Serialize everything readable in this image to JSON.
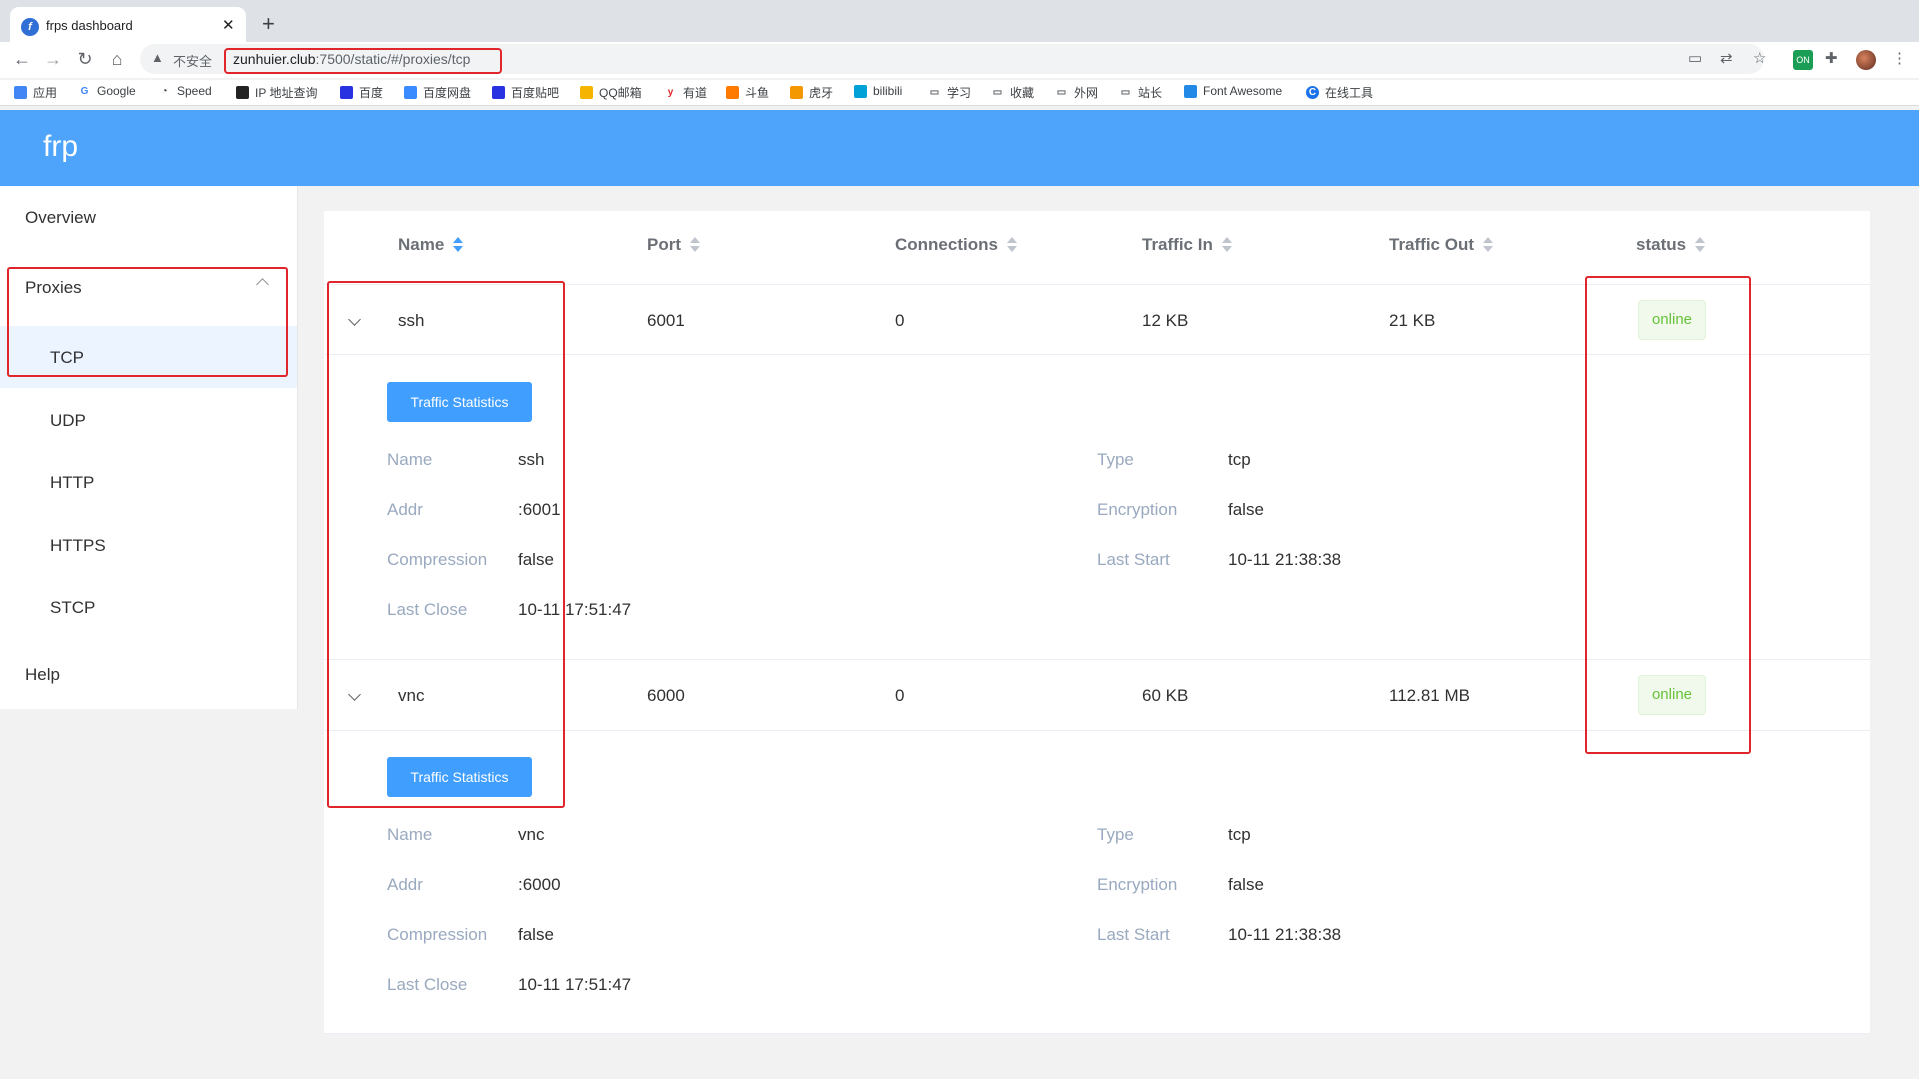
{
  "browser": {
    "tab_title": "frps dashboard",
    "tab_close": "✕",
    "new_tab": "+",
    "security_label": "不安全",
    "url_host": "zunhuier.club",
    "url_path": ":7500/static/#/proxies/tcp",
    "bookmarks": [
      "应用",
      "Google",
      "Speed",
      "IP 地址查询",
      "百度",
      "百度网盘",
      "百度贴吧",
      "QQ邮箱",
      "有道",
      "斗鱼",
      "虎牙",
      "bilibili",
      "学习",
      "收藏",
      "外网",
      "站长",
      "Font Awesome",
      "在线工具"
    ]
  },
  "app": {
    "logo": "frp",
    "menu": {
      "overview": "Overview",
      "proxies": "Proxies",
      "tcp": "TCP",
      "udp": "UDP",
      "http": "HTTP",
      "https": "HTTPS",
      "stcp": "STCP",
      "help": "Help"
    },
    "table": {
      "headers": [
        "Name",
        "Port",
        "Connections",
        "Traffic In",
        "Traffic Out",
        "status"
      ],
      "button_label": "Traffic Statistics",
      "detail_labels": {
        "name": "Name",
        "addr": "Addr",
        "compression": "Compression",
        "last_close": "Last Close",
        "type": "Type",
        "encryption": "Encryption",
        "last_start": "Last Start"
      },
      "rows": [
        {
          "name": "ssh",
          "port": "6001",
          "connections": "0",
          "traffic_in": "12 KB",
          "traffic_out": "21 KB",
          "status": "online",
          "detail": {
            "name": "ssh",
            "addr": ":6001",
            "compression": "false",
            "last_close": "10-11 17:51:47",
            "type": "tcp",
            "encryption": "false",
            "last_start": "10-11 21:38:38"
          }
        },
        {
          "name": "vnc",
          "port": "6000",
          "connections": "0",
          "traffic_in": "60 KB",
          "traffic_out": "112.81 MB",
          "status": "online",
          "detail": {
            "name": "vnc",
            "addr": ":6000",
            "compression": "false",
            "last_close": "10-11 17:51:47",
            "type": "tcp",
            "encryption": "false",
            "last_start": "10-11 21:38:38"
          }
        }
      ]
    }
  },
  "colors": {
    "header": "#4ea4fb",
    "primary": "#409eff",
    "success": "#67c23a",
    "highlight": "#e0262b"
  }
}
